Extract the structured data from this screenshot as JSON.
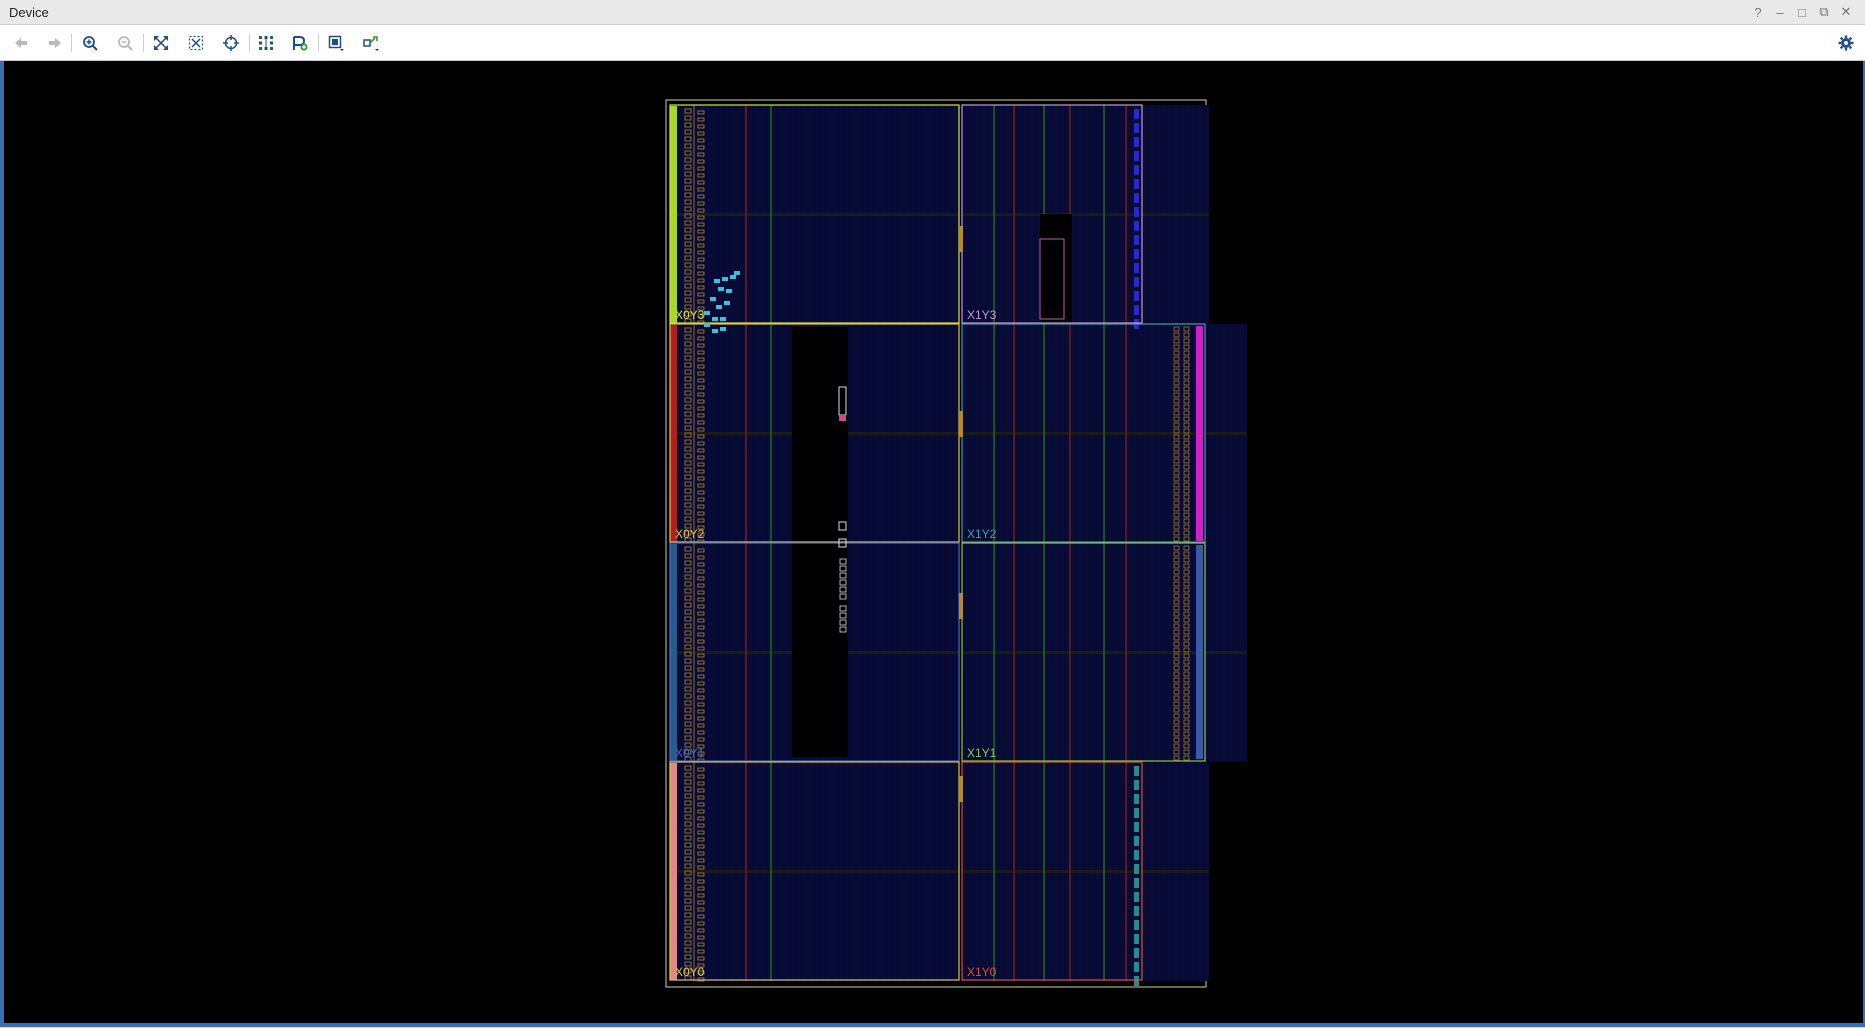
{
  "window": {
    "title": "Device"
  },
  "window_controls": [
    "?",
    "–",
    "□",
    "⧉",
    "✕"
  ],
  "toolbar": {
    "buttons": [
      {
        "name": "back-button",
        "icon": "arrow-left-icon",
        "enabled": false
      },
      {
        "name": "forward-button",
        "icon": "arrow-right-icon",
        "enabled": false
      },
      {
        "name": "zoom-in-button",
        "icon": "zoom-in-icon",
        "enabled": true
      },
      {
        "name": "zoom-out-button",
        "icon": "zoom-out-icon",
        "enabled": false
      },
      {
        "name": "zoom-fit-button",
        "icon": "fit-expand-icon",
        "enabled": true
      },
      {
        "name": "zoom-to-selected-button",
        "icon": "zoom-selected-icon",
        "enabled": true
      },
      {
        "name": "auto-fit-selection-button",
        "icon": "crosshair-icon",
        "enabled": true
      },
      {
        "name": "routing-resources-button",
        "icon": "routing-grid-icon",
        "enabled": true
      },
      {
        "name": "create-pblock-button",
        "icon": "pblock-add-icon",
        "enabled": true
      },
      {
        "name": "views-dropdown-button",
        "icon": "layers-icon",
        "enabled": true
      },
      {
        "name": "reports-dropdown-button",
        "icon": "connect-icon",
        "enabled": true
      }
    ],
    "settings_icon": "gear-icon"
  },
  "device": {
    "clock_regions": [
      {
        "label": "X0Y3",
        "color": "#d5e04a"
      },
      {
        "label": "X1Y3",
        "color": "#c79ad6"
      },
      {
        "label": "X0Y2",
        "color": "#e0c34a"
      },
      {
        "label": "X1Y2",
        "color": "#3fa0a8"
      },
      {
        "label": "X0Y1",
        "color": "#4a68c8"
      },
      {
        "label": "X1Y1",
        "color": "#8ac84a"
      },
      {
        "label": "X0Y0",
        "color": "#e0c34a"
      },
      {
        "label": "X1Y0",
        "color": "#e0502e"
      }
    ],
    "background_color": "#000000",
    "fabric_color": "#070a33",
    "outline_color": "#cfcfa0"
  }
}
